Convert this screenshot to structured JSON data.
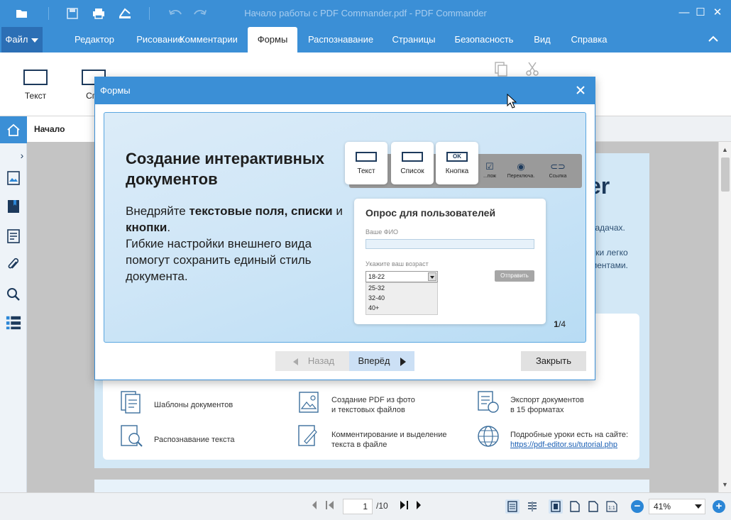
{
  "window": {
    "title": "Начало работы с PDF Commander.pdf - PDF Commander",
    "minimize": "—",
    "maximize": "☐",
    "close": "✕"
  },
  "menu": {
    "file": "Файл",
    "items": [
      "Редактор",
      "Рисование",
      "Комментарии",
      "Формы",
      "Распознавание",
      "Страницы",
      "Безопасность",
      "Вид",
      "Справка"
    ],
    "active": "Формы"
  },
  "ribbon": {
    "text_label": "Текст",
    "list_label": "Спи"
  },
  "doc_tab": {
    "label": "Начало работы"
  },
  "document": {
    "heading_fragment": "er",
    "side_lines": [
      "задачах.",
      "чки легко",
      "ментами."
    ],
    "features": [
      {
        "text": "Шаблоны документов"
      },
      {
        "text": "Создание PDF из фото\nи текстовых файлов"
      },
      {
        "text": "Экспорт документов\nв 15 форматах"
      },
      {
        "text": "Распознавание текста"
      },
      {
        "text": "Комментирование и выделение\nтекста в файле"
      },
      {
        "text": "Подробные уроки есть на сайте:"
      }
    ],
    "link": "https://pdf-editor.su/tutorial.php"
  },
  "dialog": {
    "title": "Формы",
    "heading": "Создание интерактивных документов",
    "body": {
      "p1": "Внедряйте ",
      "b1": "текстовые поля,",
      "b2": "списки",
      "p2": " и ",
      "b3": "кнопки",
      "p3": ".",
      "p4": "Гибкие настройки внешнего вида помогут сохранить единый стиль документа."
    },
    "tools": {
      "text": "Текст",
      "list": "Список",
      "button": "Кнопка",
      "sign": "...пож",
      "radio": "Переключа.",
      "link": "Ссылка"
    },
    "survey": {
      "title": "Опрос для пользователей",
      "name_label": "Ваше ФИО",
      "age_label": "Укажите ваш возраст",
      "selected": "18-22",
      "options": [
        "25-32",
        "32-40",
        "40+"
      ],
      "send": "Отправить"
    },
    "counter_current": "1",
    "counter_total": "/4",
    "back": "Назад",
    "forward": "Вперёд",
    "close": "Закрыть"
  },
  "status": {
    "page": "1",
    "total": "/10",
    "zoom": "41%"
  },
  "colors": {
    "accent": "#3b8fd6",
    "menu_file": "#2c6fb5"
  }
}
